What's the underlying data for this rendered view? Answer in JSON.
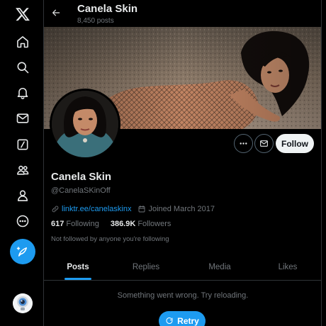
{
  "profile": {
    "display_name": "Canela Skin",
    "post_count": "8,450 posts",
    "handle": "@CanelaSKinOff",
    "link": "linktr.ee/canelaskinx",
    "joined": "Joined March 2017",
    "following_count": "617",
    "following_label": "Following",
    "followers_count": "386.9K",
    "followers_label": "Followers",
    "followed_by": "Not followed by anyone you're following"
  },
  "actions": {
    "follow_label": "Follow"
  },
  "tabs": [
    {
      "label": "Posts",
      "active": true
    },
    {
      "label": "Replies",
      "active": false
    },
    {
      "label": "Media",
      "active": false
    },
    {
      "label": "Likes",
      "active": false
    }
  ],
  "feed": {
    "error_text": "Something went wrong. Try reloading.",
    "retry_label": "Retry"
  },
  "nav": {
    "icons": [
      "x-logo-icon",
      "home-icon",
      "search-icon",
      "notifications-icon",
      "messages-icon",
      "grok-icon",
      "communities-icon",
      "profile-icon",
      "more-icon",
      "post-icon"
    ]
  },
  "colors": {
    "accent": "#1d9bf0",
    "background": "#000000",
    "text_primary": "#e7e9ea",
    "text_secondary": "#71767b",
    "border": "#2f3336"
  }
}
